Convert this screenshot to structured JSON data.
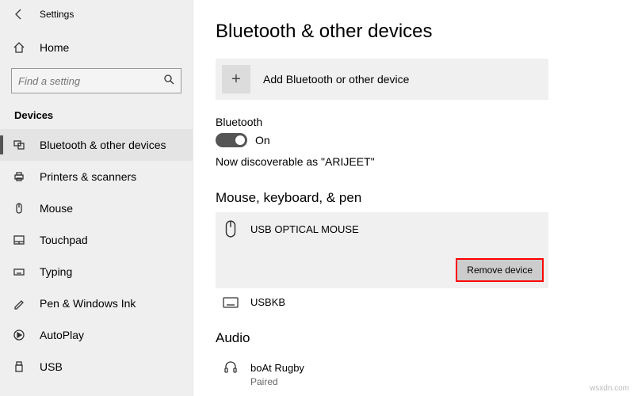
{
  "window": {
    "title": "Settings"
  },
  "sidebar": {
    "home": "Home",
    "search_placeholder": "Find a setting",
    "category": "Devices",
    "items": [
      {
        "label": "Bluetooth & other devices"
      },
      {
        "label": "Printers & scanners"
      },
      {
        "label": "Mouse"
      },
      {
        "label": "Touchpad"
      },
      {
        "label": "Typing"
      },
      {
        "label": "Pen & Windows Ink"
      },
      {
        "label": "AutoPlay"
      },
      {
        "label": "USB"
      }
    ]
  },
  "main": {
    "title": "Bluetooth & other devices",
    "add_label": "Add Bluetooth or other device",
    "bluetooth_label": "Bluetooth",
    "bluetooth_state": "On",
    "discoverable": "Now discoverable as \"ARIJEET\"",
    "sections": {
      "mouse": {
        "title": "Mouse, keyboard, & pen",
        "devices": [
          {
            "name": "USB OPTICAL MOUSE"
          },
          {
            "name": "USBKB"
          }
        ],
        "remove_label": "Remove device"
      },
      "audio": {
        "title": "Audio",
        "devices": [
          {
            "name": "boAt Rugby",
            "status": "Paired"
          }
        ]
      }
    }
  },
  "watermark": "wsxdn.com"
}
